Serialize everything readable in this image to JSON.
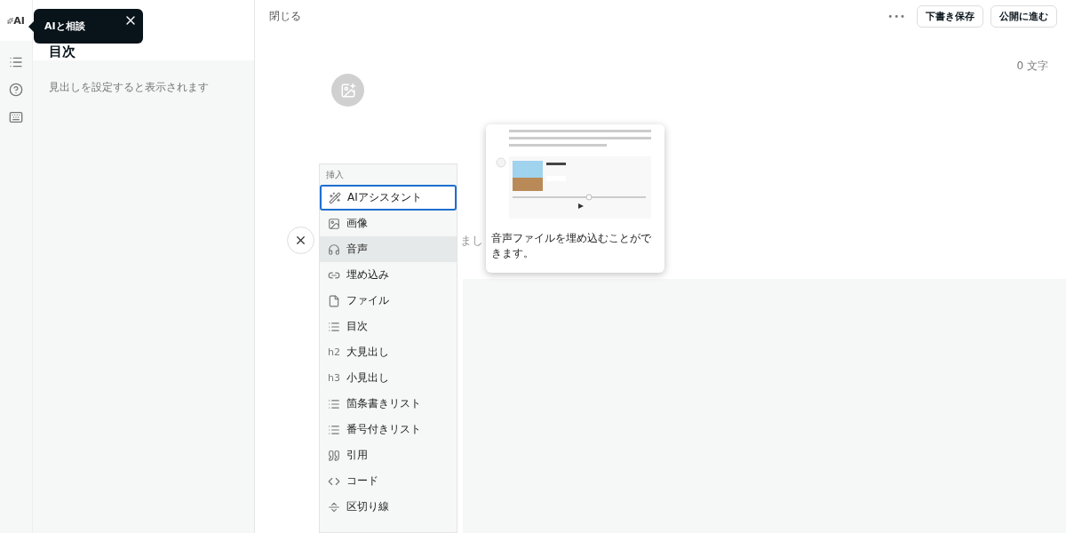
{
  "rail": {
    "ai_label": "AI"
  },
  "tooltip": {
    "text": "AIと相談"
  },
  "sidebar": {
    "title": "目次",
    "hint": "見出しを設定すると表示されます"
  },
  "topbar": {
    "close": "閉じる",
    "more": "•••",
    "buttons": [
      "下書き保存",
      "公開に進む"
    ]
  },
  "counter": "0 文字",
  "body_fragment": "まし",
  "insert_menu": {
    "title": "挿入",
    "items": [
      {
        "label": "AIアシスタント",
        "selected": true,
        "hovered": false
      },
      {
        "label": "画像",
        "selected": false,
        "hovered": false
      },
      {
        "label": "音声",
        "selected": false,
        "hovered": true
      },
      {
        "label": "埋め込み",
        "selected": false,
        "hovered": false
      },
      {
        "label": "ファイル",
        "selected": false,
        "hovered": false
      },
      {
        "label": "目次",
        "selected": false,
        "hovered": false
      },
      {
        "icon_text": "h2",
        "label": "大見出し",
        "selected": false,
        "hovered": false
      },
      {
        "icon_text": "h3",
        "label": "小見出し",
        "selected": false,
        "hovered": false
      },
      {
        "label": "箇条書きリスト",
        "selected": false,
        "hovered": false
      },
      {
        "label": "番号付きリスト",
        "selected": false,
        "hovered": false
      },
      {
        "label": "引用",
        "selected": false,
        "hovered": false
      },
      {
        "label": "コード",
        "selected": false,
        "hovered": false
      },
      {
        "label": "区切り線",
        "selected": false,
        "hovered": false
      }
    ]
  },
  "preview": {
    "kind": "picture",
    "caption": "音声ファイルを埋め込むことができます。"
  }
}
